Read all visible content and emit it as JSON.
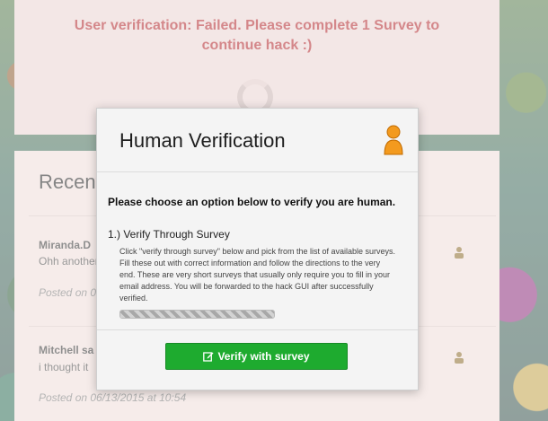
{
  "banner": {
    "message_line1": "User verification: Failed. Please complete 1 Survey to",
    "message_line2": "continue hack :)"
  },
  "comments": {
    "title": "Recent Comments",
    "items": [
      {
        "author": "Miranda.D",
        "text": "Ohh another",
        "date": "Posted on 0"
      },
      {
        "author": "Mitchell sa",
        "text": "i thought it",
        "date": "Posted on 06/13/2015 at 10:54"
      }
    ]
  },
  "modal": {
    "title": "Human Verification",
    "avatar_icon": "user-avatar-icon",
    "prompt": "Please choose an option below to verify you are human.",
    "option_title": "1.) Verify Through Survey",
    "option_desc": "Click \"verify through survey\" below and pick from the list of available surveys. Fill these out with correct information and follow the directions to the very end. These are very short surveys that usually only require you to fill in your email address. You will be forwarded to the hack GUI after successfully verified.",
    "progress_fraction": 1.0,
    "button_label": "Verify with survey",
    "button_icon": "edit-icon"
  },
  "colors": {
    "error_text": "#b1262b",
    "button_green": "#1eab2f",
    "avatar_orange": "#f39a1e"
  }
}
